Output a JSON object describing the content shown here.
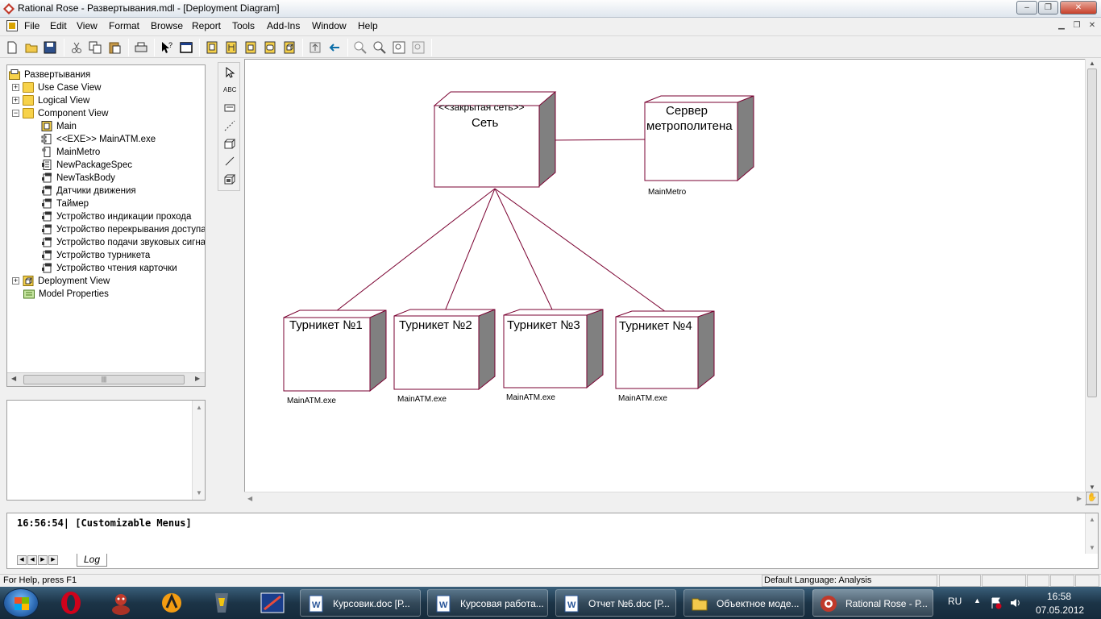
{
  "window": {
    "title": "Rational Rose - Развертывания.mdl - [Deployment Diagram]",
    "controls": {
      "minimize": "‒",
      "restore": "❐",
      "close": "✕"
    }
  },
  "menu": {
    "items": [
      "File",
      "Edit",
      "View",
      "Format",
      "Browse",
      "Report",
      "Tools",
      "Add-Ins",
      "Window",
      "Help"
    ]
  },
  "browser": {
    "root": "Развертывания",
    "items": [
      {
        "label": "Use Case View",
        "icon": "folder-icon"
      },
      {
        "label": "Logical View",
        "icon": "folder-icon"
      },
      {
        "label": "Component View",
        "icon": "folder-icon"
      },
      {
        "label": "Main",
        "icon": "component-diagram-icon"
      },
      {
        "label": "<<EXE>> MainATM.exe",
        "icon": "component-icon"
      },
      {
        "label": "MainMetro",
        "icon": "component-icon"
      },
      {
        "label": "NewPackageSpec",
        "icon": "package-spec-icon"
      },
      {
        "label": "NewTaskBody",
        "icon": "task-body-icon"
      },
      {
        "label": "Датчики движения",
        "icon": "task-body-icon"
      },
      {
        "label": "Таймер",
        "icon": "task-body-icon"
      },
      {
        "label": "Устройство индикации прохода",
        "icon": "task-body-icon"
      },
      {
        "label": "Устройство перекрывания доступа",
        "icon": "task-body-icon"
      },
      {
        "label": "Устройство подачи звуковых сигнал",
        "icon": "task-body-icon"
      },
      {
        "label": "Устройство турникета",
        "icon": "task-body-icon"
      },
      {
        "label": "Устройство чтения карточки",
        "icon": "task-body-icon"
      },
      {
        "label": "Deployment View",
        "icon": "deployment-icon"
      },
      {
        "label": "Model Properties",
        "icon": "properties-icon"
      }
    ]
  },
  "diagram": {
    "nodes": [
      {
        "stereotype": "<<закрытая сеть>>",
        "name": "Сеть"
      },
      {
        "name_line1": "Сервер",
        "name_line2": "метрополитена",
        "note": "MainMetro"
      },
      {
        "name": "Турникет №1",
        "note": "MainATM.exe"
      },
      {
        "name": "Турникет №2",
        "note": "MainATM.exe"
      },
      {
        "name": "Турникет №3",
        "note": "MainATM.exe"
      },
      {
        "name": "Турникет №4",
        "note": "MainATM.exe"
      }
    ],
    "colors": {
      "node_border": "#7a0030",
      "node_shadow": "#808080"
    }
  },
  "log": {
    "text": "16:56:54|  [Customizable Menus]",
    "tab": "Log"
  },
  "status": {
    "help": "For Help, press F1",
    "language": "Default Language: Analysis"
  },
  "taskbar": {
    "tasks": [
      "Курсовик.doc [Р...",
      "Курсовая работа...",
      "Отчет №6.doc [Р...",
      "Объектное моде...",
      "Rational Rose - Р..."
    ],
    "lang": "RU",
    "time": "16:58",
    "date": "07.05.2012"
  }
}
